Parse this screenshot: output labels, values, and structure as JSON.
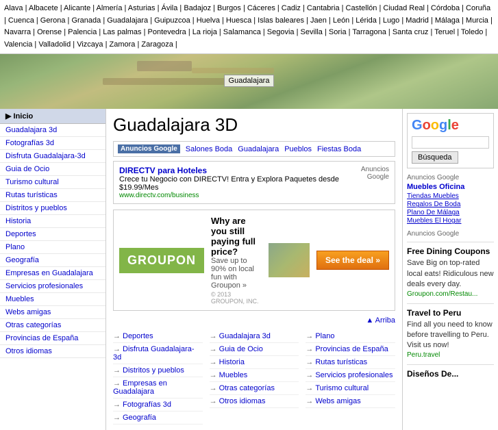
{
  "topnav": {
    "cities": "Alava | Albacete | Alicante | Almería | Asturias | Ávila | Badajoz | Burgos | Cáceres | Cadiz | Cantabria | Castellón | Ciudad Real | Córdoba | Coruña | Cuenca | Gerona | Granada | Guadalajara | Guipuzcoa | Huelva | Huesca | Islas baleares | Jaen | León | Lérida | Lugo | Madrid | Málaga | Murcia | Navarra | Orense | Palencia | Las palmas | Pontevedra | La rioja | Salamanca | Segovia | Sevilla | Soria | Tarragona | Santa cruz | Teruel | Toledo | Valencia | Valladolid | Vizcaya | Zamora | Zaragoza |"
  },
  "map": {
    "label": "Guadalajara"
  },
  "sidebar": {
    "inicio_label": "▶ Inicio",
    "items": [
      {
        "label": "Guadalajara 3d",
        "id": "guadalajara-3d"
      },
      {
        "label": "Fotografías 3d",
        "id": "fotografias-3d"
      },
      {
        "label": "Disfruta Guadalajara-3d",
        "id": "disfruta"
      },
      {
        "label": "Guia de Ocio",
        "id": "guia-ocio"
      },
      {
        "label": "Turismo cultural",
        "id": "turismo"
      },
      {
        "label": "Rutas turísticas",
        "id": "rutas"
      },
      {
        "label": "Distritos y pueblos",
        "id": "distritos"
      },
      {
        "label": "Historia",
        "id": "historia"
      },
      {
        "label": "Deportes",
        "id": "deportes"
      },
      {
        "label": "Plano",
        "id": "plano"
      },
      {
        "label": "Geografía",
        "id": "geografia"
      },
      {
        "label": "Empresas en Guadalajara",
        "id": "empresas"
      },
      {
        "label": "Servicios profesionales",
        "id": "servicios"
      },
      {
        "label": "Muebles",
        "id": "muebles"
      },
      {
        "label": "Webs amigas",
        "id": "webs"
      },
      {
        "label": "Otras categorías",
        "id": "otras"
      },
      {
        "label": "Provincias de España",
        "id": "provincias"
      },
      {
        "label": "Otros idiomas",
        "id": "otros-idiomas"
      }
    ]
  },
  "center": {
    "title": "Guadalajara 3D",
    "ad_label": "Anuncios Google",
    "ad_links": [
      "Salones Boda",
      "Guadalajara",
      "Pueblos",
      "Fiestas Boda"
    ],
    "directv": {
      "title": "DIRECTV para Hoteles",
      "desc": "Crece tu Negocio con DIRECTV! Entra y Explora Paquetes desde $19.99/Mes",
      "url": "www.directv.com/business",
      "anuncios": "Anuncios Google"
    },
    "groupon": {
      "question": "Why are you still paying full price?",
      "subtext": "Save up to 90% on local fun with Groupon »",
      "btn_label": "See the deal »",
      "logo": "GROUPON",
      "copyright": "© 2013 GROUPON, INC."
    },
    "arriba": "▲ Arriba",
    "bottom_links_col1": [
      {
        "label": "Deportes"
      },
      {
        "label": "Disfruta Guadalajara-3d"
      },
      {
        "label": "Distritos y pueblos"
      },
      {
        "label": "Empresas en Guadalajara"
      },
      {
        "label": "Fotografías 3d"
      },
      {
        "label": "Geografía"
      }
    ],
    "bottom_links_col2": [
      {
        "label": "Guadalajara 3d"
      },
      {
        "label": "Guia de Ocio"
      },
      {
        "label": "Historia"
      },
      {
        "label": "Muebles"
      },
      {
        "label": "Otras categorías"
      },
      {
        "label": "Otros idiomas"
      }
    ],
    "bottom_links_col3": [
      {
        "label": "Plano"
      },
      {
        "label": "Provincias de España"
      },
      {
        "label": "Rutas turísticas"
      },
      {
        "label": "Servicios profesionales"
      },
      {
        "label": "Turismo cultural"
      },
      {
        "label": "Webs amigas"
      }
    ]
  },
  "right": {
    "google_logo": "Google",
    "search_placeholder": "",
    "search_btn": "Búsqueda",
    "anuncios_label": "Anuncios Google",
    "ad_links": [
      "Muebles Oficina",
      "Tiendas Muebles",
      "Regalos De Boda",
      "Plano De Málaga",
      "Muebles El Hogar"
    ],
    "anuncios_label2": "Anuncios Google",
    "free_dining": {
      "title": "Free Dining Coupons",
      "text1": "Save Big on top-rated local eats!",
      "text2": "Ridiculous new deals every day.",
      "url": "Groupon.com/Restau..."
    },
    "travel_peru": {
      "title": "Travel to Peru",
      "text1": "Find all you need to know before travelling to Peru. Visit us now!",
      "url": "Peru.travel"
    },
    "disenos": {
      "title": "Diseños De..."
    }
  }
}
